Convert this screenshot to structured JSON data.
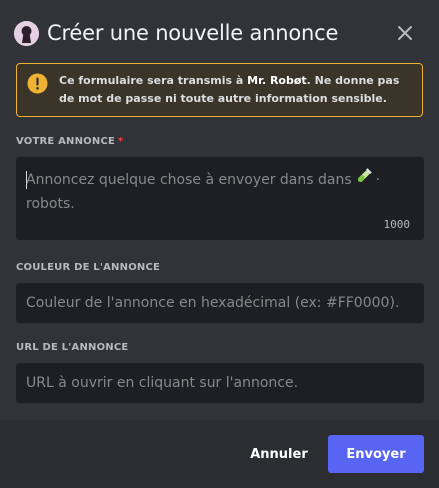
{
  "header": {
    "title": "Créer une nouvelle annonce",
    "app_icon": "keyhole-avatar-icon",
    "close_icon": "close-icon"
  },
  "warning": {
    "icon": "exclamation-circle-icon",
    "text_prefix": "Ce formulaire sera transmis à ",
    "app_name": "Mr. Robøt",
    "text_suffix": ". Ne donne pas de mot de passe ni toute autre information sensible.",
    "color": "#f0b232"
  },
  "fields": {
    "announcement": {
      "label": "Votre annonce",
      "required_mark": "*",
      "placeholder_part1": "Annoncez quelque chose à envoyer dans  dans",
      "emoji": "test-tube-emoji",
      "placeholder_part2": "·",
      "placeholder_part3": "robots.",
      "counter": "1000"
    },
    "color": {
      "label": "Couleur de l'annonce",
      "placeholder": "Couleur de l'annonce en hexadécimal (ex: #FF0000)."
    },
    "url": {
      "label": "URL de l'annonce",
      "placeholder": "URL à ouvrir en cliquant sur l'annonce."
    }
  },
  "footer": {
    "cancel_label": "Annuler",
    "submit_label": "Envoyer",
    "submit_color": "#5865f2"
  }
}
